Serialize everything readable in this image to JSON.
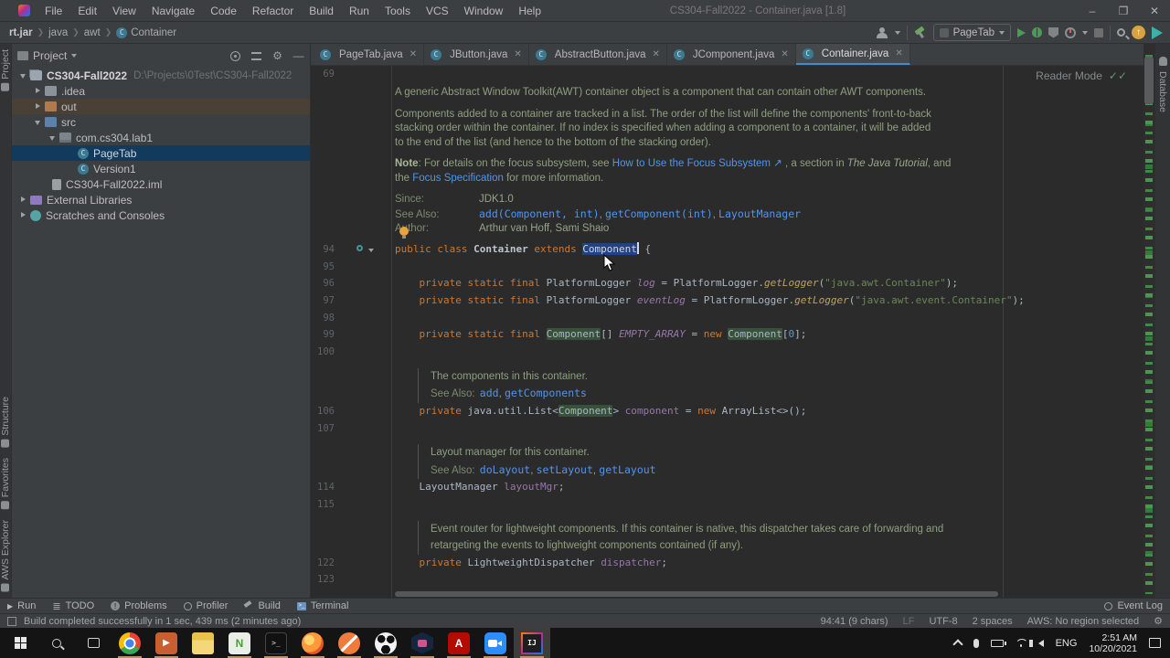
{
  "titlebar": {
    "menus": [
      "File",
      "Edit",
      "View",
      "Navigate",
      "Code",
      "Refactor",
      "Build",
      "Run",
      "Tools",
      "VCS",
      "Window",
      "Help"
    ],
    "title": "CS304-Fall2022 - Container.java [1.8]",
    "minimize": "–",
    "maximize": "❐",
    "close": "✕"
  },
  "navbar": {
    "breadcrumbs": [
      "rt.jar",
      "java",
      "awt",
      "Container"
    ],
    "run_config": "PageTab"
  },
  "side_stripes": {
    "left": [
      "Project",
      "Structure",
      "Favorites",
      "AWS Explorer"
    ],
    "right": [
      "Database"
    ]
  },
  "project_panel": {
    "header": "Project",
    "tree": [
      {
        "label": "CS304-Fall2022",
        "path": "D:\\Projects\\0Test\\CS304-Fall2022"
      },
      {
        "label": ".idea"
      },
      {
        "label": "out"
      },
      {
        "label": "src"
      },
      {
        "label": "com.cs304.lab1"
      },
      {
        "label": "PageTab"
      },
      {
        "label": "Version1"
      },
      {
        "label": "CS304-Fall2022.iml"
      },
      {
        "label": "External Libraries"
      },
      {
        "label": "Scratches and Consoles"
      }
    ]
  },
  "tabs": [
    {
      "label": "PageTab.java"
    },
    {
      "label": "JButton.java"
    },
    {
      "label": "AbstractButton.java"
    },
    {
      "label": "JComponent.java"
    },
    {
      "label": "Container.java"
    }
  ],
  "editor": {
    "reader_mode": "Reader Mode",
    "nums": {
      "l69": "69",
      "l94": "94",
      "l95": "95",
      "l96": "96",
      "l97": "97",
      "l98": "98",
      "l99": "99",
      "l100": "100",
      "l106": "106",
      "l107": "107",
      "l114": "114",
      "l115": "115",
      "l122": "122",
      "l123": "123"
    },
    "bigdoc": {
      "p1": [
        {
          "t": "A generic Abstract Window Toolkit(AWT) container object is a component that can contain other AWT components.",
          "c": "doc"
        }
      ],
      "p2a": [
        {
          "t": "Components added to a container are tracked in a list. The order of the list will define the components' front-to-back",
          "c": "doc"
        }
      ],
      "p2b": [
        {
          "t": "stacking order within the container. If no index is specified when adding a component to a container, it will be added",
          "c": "doc"
        }
      ],
      "p2c": [
        {
          "t": "to the end of the list (and hence to the bottom of the stacking order).",
          "c": "doc"
        }
      ],
      "p3a": [
        {
          "t": "Note",
          "c": "docb"
        },
        {
          "t": ": For details on the focus subsystem, see ",
          "c": "doc"
        },
        {
          "t": "How to Use the Focus Subsystem ↗",
          "c": "dlink"
        },
        {
          "t": " , a section in ",
          "c": "doc"
        },
        {
          "t": "The Java Tutorial",
          "c": "doci"
        },
        {
          "t": ", and",
          "c": "doc"
        }
      ],
      "p3b": [
        {
          "t": "the ",
          "c": "doc"
        },
        {
          "t": "Focus Specification",
          "c": "dlink"
        },
        {
          "t": " for more information.",
          "c": "doc"
        }
      ],
      "since": [
        {
          "t": "Since:",
          "c": "dlab"
        },
        {
          "t": "JDK1.0",
          "c": "docv"
        }
      ],
      "seealso": [
        {
          "t": "See Also:",
          "c": "dlab"
        },
        {
          "t": "add(Component, int)",
          "c": "mlink"
        },
        {
          "t": ", ",
          "c": "docv"
        },
        {
          "t": "getComponent(int)",
          "c": "mlink"
        },
        {
          "t": ", ",
          "c": "docv"
        },
        {
          "t": "LayoutManager",
          "c": "mlink"
        }
      ],
      "author": [
        {
          "t": "Author:",
          "c": "dlab"
        },
        {
          "t": "Arthur van Hoff, Sami Shaio",
          "c": "docv"
        }
      ]
    },
    "lines": {
      "l94": [
        {
          "t": "public class ",
          "c": "kw"
        },
        {
          "t": "Container ",
          "c": "cls b"
        },
        {
          "t": "extends ",
          "c": "kw"
        },
        {
          "t": "Component",
          "c": "sel"
        },
        {
          "t": "",
          "c": "caret"
        },
        {
          "t": " {",
          "c": "pln"
        }
      ],
      "l96": [
        {
          "t": "    ",
          "c": "pln"
        },
        {
          "t": "private static final ",
          "c": "kw"
        },
        {
          "t": "PlatformLogger ",
          "c": "cls"
        },
        {
          "t": "log",
          "c": "sfld"
        },
        {
          "t": " = ",
          "c": "pln"
        },
        {
          "t": "PlatformLogger",
          "c": "cls"
        },
        {
          "t": ".",
          "c": "pln"
        },
        {
          "t": "getLogger",
          "c": "mth"
        },
        {
          "t": "(",
          "c": "pln"
        },
        {
          "t": "\"java.awt.Container\"",
          "c": "str"
        },
        {
          "t": ");",
          "c": "pln"
        }
      ],
      "l97": [
        {
          "t": "    ",
          "c": "pln"
        },
        {
          "t": "private static final ",
          "c": "kw"
        },
        {
          "t": "PlatformLogger ",
          "c": "cls"
        },
        {
          "t": "eventLog",
          "c": "sfld"
        },
        {
          "t": " = ",
          "c": "pln"
        },
        {
          "t": "PlatformLogger",
          "c": "cls"
        },
        {
          "t": ".",
          "c": "pln"
        },
        {
          "t": "getLogger",
          "c": "mth"
        },
        {
          "t": "(",
          "c": "pln"
        },
        {
          "t": "\"java.awt.event.Container\"",
          "c": "str"
        },
        {
          "t": ");",
          "c": "pln"
        }
      ],
      "l99": [
        {
          "t": "    ",
          "c": "pln"
        },
        {
          "t": "private static final ",
          "c": "kw"
        },
        {
          "t": "Component",
          "c": "cls occ"
        },
        {
          "t": "[] ",
          "c": "pln"
        },
        {
          "t": "EMPTY_ARRAY",
          "c": "sfld"
        },
        {
          "t": " = ",
          "c": "pln"
        },
        {
          "t": "new ",
          "c": "kw"
        },
        {
          "t": "Component",
          "c": "cls occ"
        },
        {
          "t": "[",
          "c": "pln"
        },
        {
          "t": "0",
          "c": "num"
        },
        {
          "t": "];",
          "c": "pln"
        }
      ],
      "l106": [
        {
          "t": "    ",
          "c": "pln"
        },
        {
          "t": "private ",
          "c": "kw"
        },
        {
          "t": "java.util.List<",
          "c": "pln"
        },
        {
          "t": "Component",
          "c": "cls occ"
        },
        {
          "t": "> ",
          "c": "pln"
        },
        {
          "t": "component",
          "c": "fld"
        },
        {
          "t": " = ",
          "c": "pln"
        },
        {
          "t": "new ",
          "c": "kw"
        },
        {
          "t": "ArrayList",
          "c": "cls"
        },
        {
          "t": "<>();",
          "c": "pln"
        }
      ],
      "l114": [
        {
          "t": "    ",
          "c": "pln"
        },
        {
          "t": "LayoutManager ",
          "c": "cls"
        },
        {
          "t": "layoutMgr",
          "c": "fld"
        },
        {
          "t": ";",
          "c": "pln"
        }
      ],
      "l122": [
        {
          "t": "    ",
          "c": "pln"
        },
        {
          "t": "private ",
          "c": "kw"
        },
        {
          "t": "LightweightDispatcher ",
          "c": "cls"
        },
        {
          "t": "dispatcher",
          "c": "fld"
        },
        {
          "t": ";",
          "c": "pln"
        }
      ]
    },
    "doc1": {
      "l1": [
        {
          "t": "The components in this container.",
          "c": "doc"
        }
      ],
      "l2": [
        {
          "t": "See Also: ",
          "c": "dlab2"
        },
        {
          "t": "add",
          "c": "mlink"
        },
        {
          "t": ", ",
          "c": "docv"
        },
        {
          "t": "getComponents",
          "c": "mlink"
        }
      ]
    },
    "doc2": {
      "l1": [
        {
          "t": "Layout manager for this container.",
          "c": "doc"
        }
      ],
      "l2": [
        {
          "t": "See Also: ",
          "c": "dlab2"
        },
        {
          "t": "doLayout",
          "c": "mlink"
        },
        {
          "t": ", ",
          "c": "docv"
        },
        {
          "t": "setLayout",
          "c": "mlink"
        },
        {
          "t": ", ",
          "c": "docv"
        },
        {
          "t": "getLayout",
          "c": "mlink"
        }
      ]
    },
    "doc3": {
      "l1": [
        {
          "t": "Event router for lightweight components. If this container is native, this dispatcher takes care of forwarding and",
          "c": "doc"
        }
      ],
      "l2": [
        {
          "t": "retargeting the events to lightweight components contained (if any).",
          "c": "doc"
        }
      ]
    }
  },
  "tool_window_bar": {
    "items": [
      "Run",
      "TODO",
      "Problems",
      "Profiler",
      "Build",
      "Terminal"
    ],
    "event_log": "Event Log"
  },
  "status_bar": {
    "message": "Build completed successfully in 1 sec, 439 ms (2 minutes ago)",
    "position": "94:41 (9 chars)",
    "line_separator": "LF",
    "encoding": "UTF-8",
    "indent": "2 spaces",
    "aws": "AWS: No region selected"
  },
  "taskbar": {
    "language": "ENG",
    "time": "2:51 AM",
    "date": "10/20/2021"
  }
}
